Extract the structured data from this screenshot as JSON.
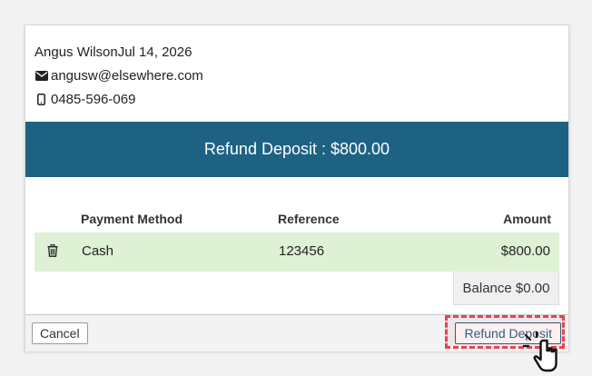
{
  "customer": {
    "name": "Angus Wilson",
    "date": "Jul 14, 2026",
    "email": "angusw@elsewhere.com",
    "phone": "0485-596-069",
    "email_icon": "envelope-icon",
    "phone_icon": "mobile-phone-icon"
  },
  "banner": {
    "label": "Refund Deposit",
    "separator": ":",
    "amount": "$800.00"
  },
  "table": {
    "headers": {
      "method": "Payment Method",
      "reference": "Reference",
      "amount": "Amount"
    },
    "rows": [
      {
        "method": "Cash",
        "reference": "123456",
        "amount": "$800.00",
        "icon": "trash-icon"
      }
    ]
  },
  "balance": "Balance $0.00",
  "footer": {
    "cancel_label": "Cancel",
    "refund_label": "Refund Deposit"
  },
  "colors": {
    "banner": "#1e6283",
    "row_background": "#dff1d4",
    "highlight": "#e8434f"
  }
}
